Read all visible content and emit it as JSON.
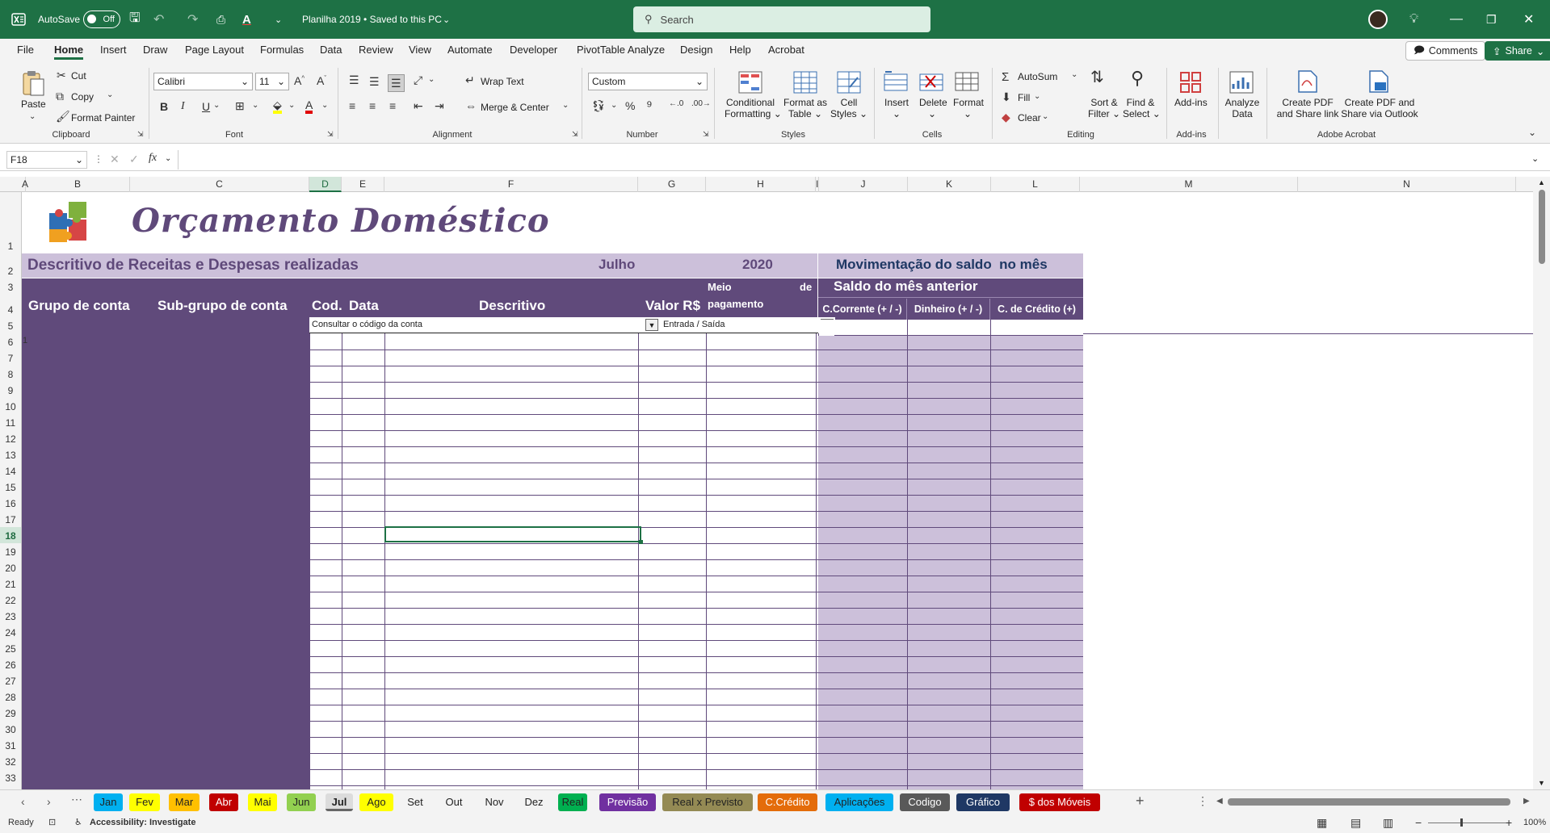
{
  "titlebar": {
    "autosave_label": "AutoSave",
    "autosave_state": "Off",
    "doc_title": "Planilha 2019 • Saved to this PC",
    "search_placeholder": "Search"
  },
  "menu": {
    "tabs": [
      "File",
      "Home",
      "Insert",
      "Draw",
      "Page Layout",
      "Formulas",
      "Data",
      "Review",
      "View",
      "Automate",
      "Developer",
      "PivotTable Analyze",
      "Design",
      "Help",
      "Acrobat"
    ],
    "active": "Home",
    "comments": "Comments",
    "share": "Share"
  },
  "ribbon": {
    "clipboard": {
      "paste": "Paste",
      "cut": "Cut",
      "copy": "Copy",
      "format_painter": "Format Painter",
      "group": "Clipboard"
    },
    "font": {
      "name": "Calibri",
      "size": "11",
      "group": "Font"
    },
    "alignment": {
      "wrap": "Wrap Text",
      "merge": "Merge & Center",
      "group": "Alignment"
    },
    "number": {
      "format": "Custom",
      "group": "Number"
    },
    "styles": {
      "cond1": "Conditional",
      "cond2": "Formatting",
      "fmt1": "Format as",
      "fmt2": "Table",
      "cell1": "Cell",
      "cell2": "Styles",
      "group": "Styles"
    },
    "cells": {
      "insert": "Insert",
      "delete": "Delete",
      "format": "Format",
      "group": "Cells"
    },
    "editing": {
      "autosum": "AutoSum",
      "fill": "Fill",
      "clear": "Clear",
      "sort1": "Sort &",
      "sort2": "Filter",
      "find1": "Find &",
      "find2": "Select",
      "group": "Editing"
    },
    "addins": {
      "label": "Add-ins",
      "group": "Add-ins"
    },
    "analyze": {
      "l1": "Analyze",
      "l2": "Data"
    },
    "acrobat": {
      "pdf1a": "Create PDF",
      "pdf1b": "and Share link",
      "pdf2a": "Create PDF and",
      "pdf2b": "Share via Outlook",
      "group": "Adobe Acrobat"
    }
  },
  "formula_bar": {
    "name_box": "F18",
    "fx": "fx",
    "value": ""
  },
  "columns": [
    "A",
    "B",
    "C",
    "D",
    "E",
    "F",
    "G",
    "H",
    "I",
    "J",
    "K",
    "L",
    "M",
    "N"
  ],
  "selected_col": "D",
  "rows": [
    "1",
    "2",
    "3",
    "4",
    "5",
    "6",
    "7",
    "8",
    "9",
    "10",
    "11",
    "12",
    "13",
    "14",
    "15",
    "16",
    "17",
    "18",
    "19",
    "20",
    "21",
    "22",
    "23",
    "24",
    "25",
    "26",
    "27",
    "28",
    "29",
    "30",
    "31",
    "32",
    "33"
  ],
  "selected_row": "18",
  "sheet": {
    "title": "Orçamento Doméstico",
    "subtitle": "Descritivo de Receitas e Despesas realizadas",
    "month": "Julho",
    "year": "2020",
    "col_grupo": "Grupo de conta",
    "col_subgrupo": "Sub-grupo de conta",
    "col_cod": "Cod.",
    "col_data": "Data",
    "col_descritivo": "Descritivo",
    "col_valor": "Valor R$",
    "col_meio1": "Meio",
    "col_meio_de": "de",
    "col_meio2": "pagamento",
    "dd_codigo": "Consultar o código da conta",
    "dd_entrada": "Entrada / Saída",
    "mov_title": "Movimentação do saldo  no mês",
    "saldo_anterior": "Saldo do mês anterior",
    "col_corrente": "C.Corrente (+ / -)",
    "col_dinheiro": "Dinheiro (+ / -)",
    "col_credito": "C. de Crédito (+)",
    "row6_marker": "1"
  },
  "sheet_tabs": [
    {
      "name": "Jan",
      "bg": "#00b0f0",
      "fg": "#222"
    },
    {
      "name": "Fev",
      "bg": "#ffff00",
      "fg": "#222"
    },
    {
      "name": "Mar",
      "bg": "#ffc000",
      "fg": "#222"
    },
    {
      "name": "Abr",
      "bg": "#c00000",
      "fg": "#fff"
    },
    {
      "name": "Mai",
      "bg": "#ffff00",
      "fg": "#222"
    },
    {
      "name": "Jun",
      "bg": "#92d050",
      "fg": "#222"
    },
    {
      "name": "Jul",
      "bg": "#e6e6e6",
      "fg": "#222",
      "active": true
    },
    {
      "name": "Ago",
      "bg": "#ffff00",
      "fg": "#222"
    },
    {
      "name": "Set",
      "bg": "",
      "fg": "#222"
    },
    {
      "name": "Out",
      "bg": "",
      "fg": "#222"
    },
    {
      "name": "Nov",
      "bg": "",
      "fg": "#222"
    },
    {
      "name": "Dez",
      "bg": "",
      "fg": "#222"
    },
    {
      "name": "Real",
      "bg": "#00b050",
      "fg": "#222"
    },
    {
      "name": "Previsão",
      "bg": "#7030a0",
      "fg": "#fff"
    },
    {
      "name": "Real x Previsto",
      "bg": "#948a54",
      "fg": "#222"
    },
    {
      "name": "C.Crédito",
      "bg": "#e46c0a",
      "fg": "#fff"
    },
    {
      "name": "Aplicações",
      "bg": "#00b0f0",
      "fg": "#222"
    },
    {
      "name": "Codigo",
      "bg": "#595959",
      "fg": "#fff"
    },
    {
      "name": "Gráfico",
      "bg": "#1f3864",
      "fg": "#fff"
    },
    {
      "name": "$ dos Móveis",
      "bg": "#c00000",
      "fg": "#fff"
    }
  ],
  "status": {
    "ready": "Ready",
    "accessibility": "Accessibility: Investigate",
    "zoom": "100%"
  },
  "colors": {
    "excel_green": "#1e7145",
    "purple_dark": "#604a7b",
    "purple_light": "#ccc0da",
    "title_purple": "#5f497a"
  }
}
